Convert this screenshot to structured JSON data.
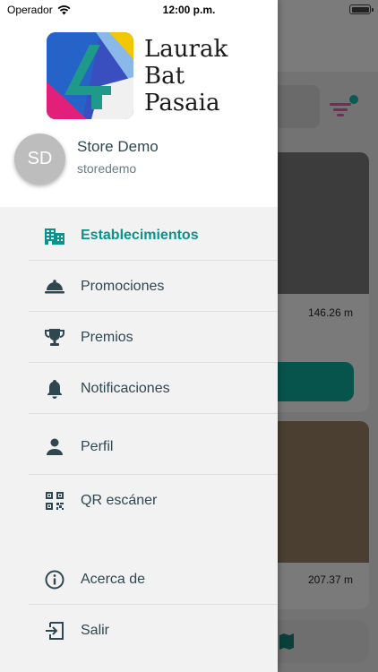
{
  "status_bar": {
    "carrier": "Operador",
    "time": "12:00 p.m."
  },
  "app": {
    "logo_lines": [
      "Laurak",
      "Bat",
      "Pasaia"
    ]
  },
  "user": {
    "initials": "SD",
    "name": "Store Demo",
    "handle": "storedemo"
  },
  "menu": [
    {
      "label": "Establecimientos",
      "icon": "building-icon",
      "active": true
    },
    {
      "label": "Promociones",
      "icon": "cloche-icon",
      "active": false
    },
    {
      "label": "Premios",
      "icon": "trophy-icon",
      "active": false
    },
    {
      "label": "Notificaciones",
      "icon": "bell-icon",
      "active": false
    },
    {
      "label": "Perfil",
      "icon": "person-icon",
      "active": false
    },
    {
      "label": "QR escáner",
      "icon": "qr-code-icon",
      "active": false
    },
    {
      "label": "Acerca de",
      "icon": "info-icon",
      "active": false
    },
    {
      "label": "Salir",
      "icon": "logout-icon",
      "active": false
    }
  ],
  "background": {
    "cards": [
      {
        "distance": "146.26 m"
      },
      {
        "distance": "207.37 m"
      }
    ]
  },
  "colors": {
    "accent": "#08948a",
    "text": "#2f4750",
    "filter_accent": "#c2187e",
    "badge": "#0a8f86"
  }
}
